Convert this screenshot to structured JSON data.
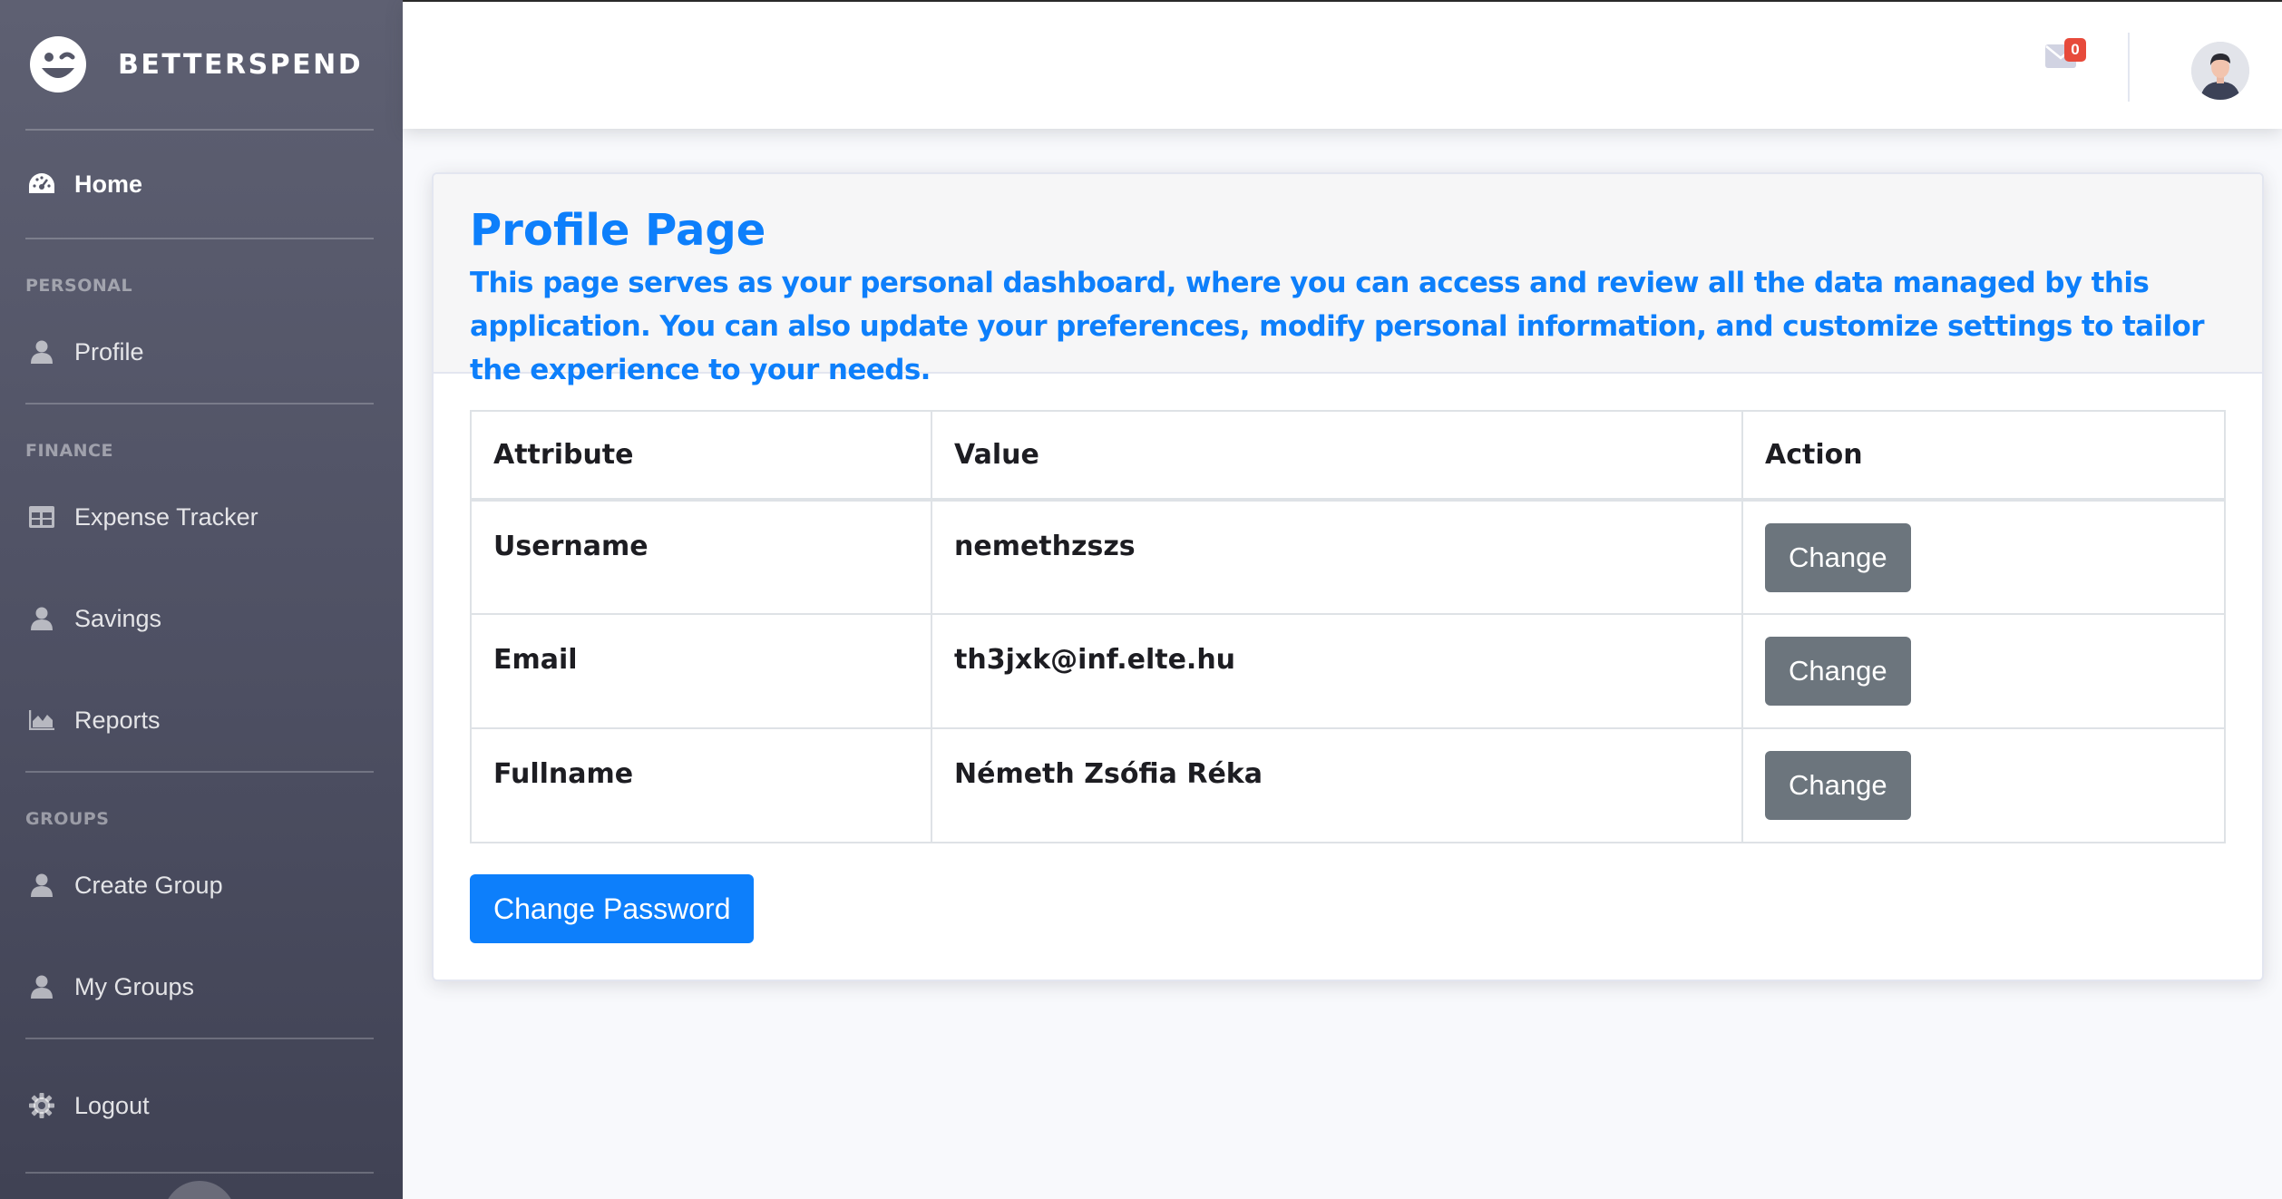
{
  "brand": {
    "name": "BETTERSPEND",
    "logo_icon": "smiley-wink-icon"
  },
  "sidebar": {
    "home": {
      "label": "Home",
      "icon": "tachometer-icon"
    },
    "sections": [
      {
        "heading": "PERSONAL",
        "items": [
          {
            "label": "Profile",
            "icon": "user-icon"
          }
        ]
      },
      {
        "heading": "FINANCE",
        "items": [
          {
            "label": "Expense Tracker",
            "icon": "table-icon"
          },
          {
            "label": "Savings",
            "icon": "user-icon"
          },
          {
            "label": "Reports",
            "icon": "area-chart-icon"
          }
        ]
      },
      {
        "heading": "GROUPS",
        "items": [
          {
            "label": "Create Group",
            "icon": "user-icon"
          },
          {
            "label": "My Groups",
            "icon": "user-icon"
          }
        ]
      }
    ],
    "logout": {
      "label": "Logout",
      "icon": "gear-icon"
    }
  },
  "topbar": {
    "messages_count": "0",
    "mail_icon": "envelope-icon",
    "avatar_icon": "user-avatar-icon"
  },
  "profile": {
    "title": "Profile Page",
    "description": "This page serves as your personal dashboard, where you can access and review all the data managed by this application. You can also update your preferences, modify personal information, and customize settings to tailor the experience to your needs.",
    "table": {
      "headers": [
        "Attribute",
        "Value",
        "Action"
      ],
      "rows": [
        {
          "attribute": "Username",
          "value": "nemethzszs",
          "action": "Change"
        },
        {
          "attribute": "Email",
          "value": "th3jxk@inf.elte.hu",
          "action": "Change"
        },
        {
          "attribute": "Fullname",
          "value": "Németh Zsófia Réka",
          "action": "Change"
        }
      ]
    },
    "change_password_label": "Change Password"
  },
  "colors": {
    "primary": "#0d7ffb",
    "secondary": "#6c757d",
    "badge": "#e74a3b",
    "sidebar": "#4e5063"
  }
}
